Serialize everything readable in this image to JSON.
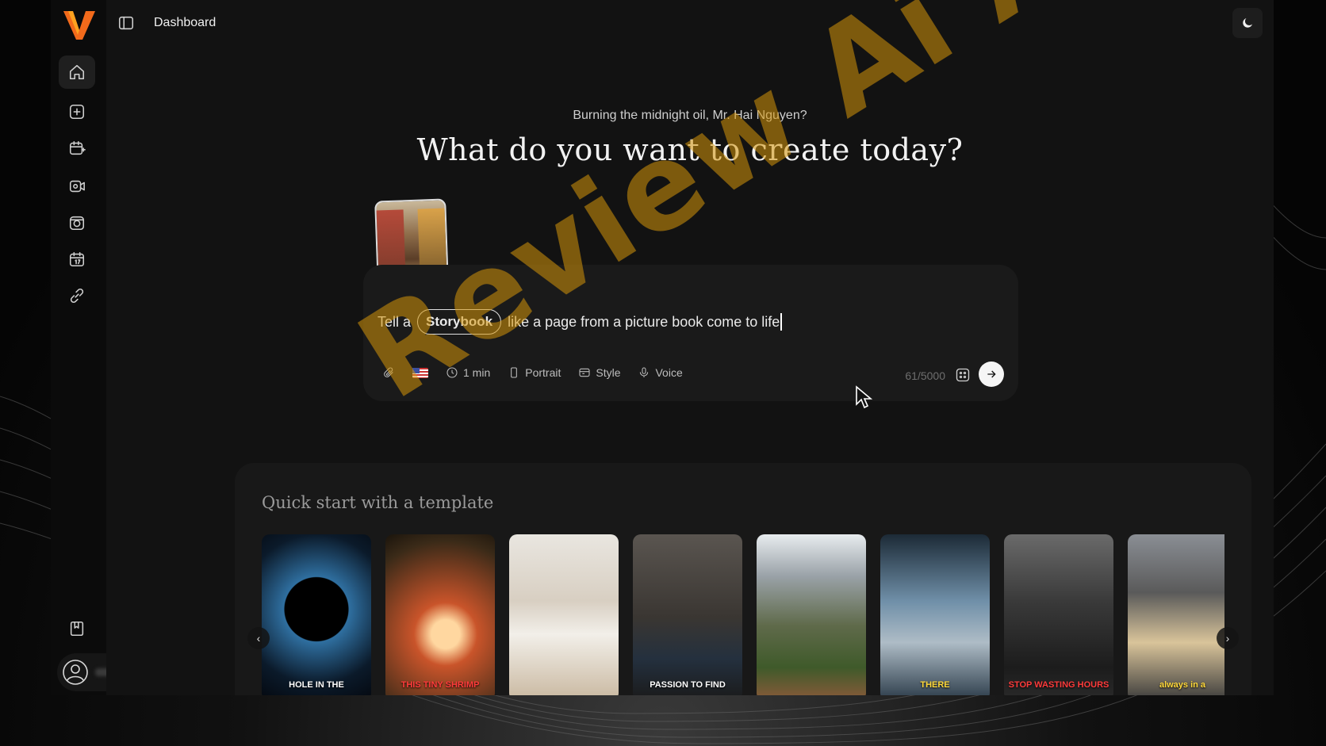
{
  "app": {
    "page_title": "Dashboard"
  },
  "sidebar": {
    "items": [
      {
        "icon": "home-icon"
      },
      {
        "icon": "plus-square-icon"
      },
      {
        "icon": "calendar-plus-icon"
      },
      {
        "icon": "video-camera-icon"
      },
      {
        "icon": "photo-camera-icon"
      },
      {
        "icon": "calendar-icon"
      },
      {
        "icon": "link-icon"
      }
    ],
    "bottom_icon": "book-icon",
    "user_icon": "user-circle-icon"
  },
  "header": {
    "greeting": "Burning the midnight oil, Mr. Hai Nguyen?",
    "headline": "What do you want to create today?"
  },
  "prompt": {
    "prefix": "Tell a",
    "chip": "Storybook",
    "suffix": "like a page from a picture book come to life",
    "counter": "61/5000",
    "toolbar": {
      "duration": "1 min",
      "orientation": "Portrait",
      "style": "Style",
      "voice": "Voice"
    }
  },
  "templates": {
    "title": "Quick start with a template",
    "cards": [
      {
        "caption": "HOLE IN THE",
        "caption_color": "white"
      },
      {
        "caption": "THIS TINY SHRIMP",
        "caption_color": "red"
      },
      {
        "caption": "",
        "caption_color": "white"
      },
      {
        "caption": "PASSION TO FIND",
        "caption_color": "white"
      },
      {
        "caption": "",
        "caption_color": "white"
      },
      {
        "caption": "THERE",
        "caption_color": "yellow"
      },
      {
        "caption": "STOP WASTING HOURS",
        "caption_color": "red"
      },
      {
        "caption": "always in a",
        "caption_color": "yellow"
      }
    ]
  },
  "watermark": "Review Ai Apps",
  "colors": {
    "background": "#121212",
    "sidebar": "#0b0b0b",
    "card": "#1a1a1a",
    "logo_orange": "#f26a1b",
    "watermark": "#d6960a"
  }
}
